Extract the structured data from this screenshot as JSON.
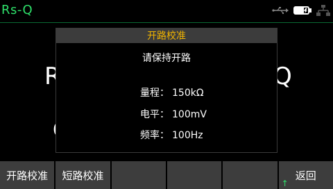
{
  "header": {
    "mode_title": "Rs-Q",
    "icons": [
      "usb-icon",
      "battery-icon",
      "lan-icon"
    ]
  },
  "background": {
    "left_glyph": "R",
    "right_glyph": "Q",
    "left_glyph_2": "C"
  },
  "dialog": {
    "title": "开路校准",
    "message": "请保持开路",
    "params": [
      {
        "label": "量程：",
        "value": "150kΩ"
      },
      {
        "label": "电平：",
        "value": "100mV"
      },
      {
        "label": "频率：",
        "value": "100Hz"
      }
    ]
  },
  "softkeys": [
    "开路校准",
    "短路校准",
    "",
    "",
    "",
    "返回"
  ],
  "colors": {
    "mode_title": "#2ee06a",
    "dialog_title": "#f0b400",
    "softkey_bg": "#3d3d3d",
    "dialog_header_bg": "#3c3c3c"
  }
}
